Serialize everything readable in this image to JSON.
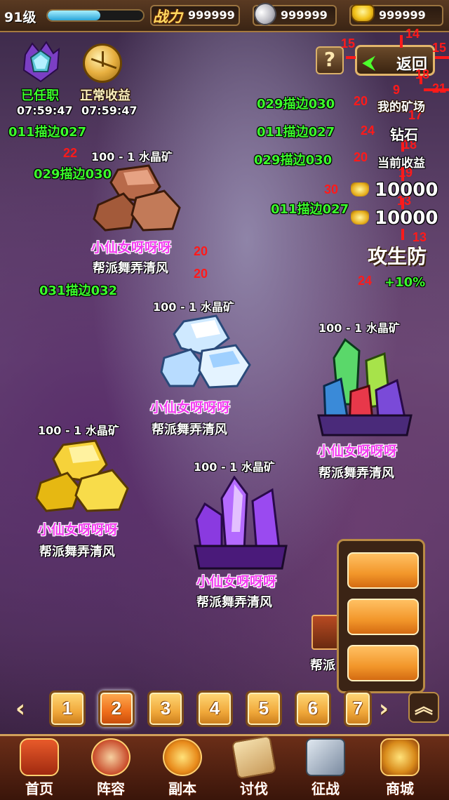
{
  "topbar": {
    "level": "91级",
    "power_label": "战力",
    "power_value": "999999",
    "silver_value": "999999",
    "gold_value": "999999",
    "xp_fraction": 0.55
  },
  "header_buttons": {
    "help_label": "?",
    "back_label": "返回"
  },
  "status_icons": [
    {
      "label": "已任职",
      "timer": "07:59:47"
    },
    {
      "label": "正常收益",
      "timer": "07:59:47"
    }
  ],
  "annotations": {
    "a_top_left": "011描边027",
    "a_left_2": "029描边030",
    "a_left_3": "031描边032",
    "a_right_1": "029描边030",
    "a_right_2": "011描边027",
    "a_right_3": "029描边030",
    "a_right_4": "011描边027"
  },
  "red_numbers": {
    "n15a": "15",
    "n14": "14",
    "n15b": "15",
    "n18a": "18",
    "n21": "21",
    "n9": "9",
    "n20a": "20",
    "n17": "17",
    "n24a": "24",
    "n18b": "18",
    "n20b": "20",
    "n19": "19",
    "n30": "30",
    "n13a": "13",
    "n13b": "13",
    "n24b": "24",
    "n22": "22",
    "n20c": "20",
    "n20d": "20"
  },
  "info_panel": {
    "my_mine": "我的矿场",
    "diamond": "钻石",
    "current_income": "当前收益",
    "income_1": "10000",
    "income_2": "10000",
    "atk_def": "攻生防",
    "bonus": "+10%"
  },
  "mines": [
    {
      "title": "100 - 1 水晶矿",
      "owner": "小仙女呀呀呀",
      "guild": "帮派舞弄清风",
      "type": "brown"
    },
    {
      "title": "100 - 1 水晶矿",
      "owner": "小仙女呀呀呀",
      "guild": "帮派舞弄清风",
      "type": "diamond"
    },
    {
      "title": "100 - 1 水晶矿",
      "owner": "小仙女呀呀呀",
      "guild": "帮派舞弄清风",
      "type": "rainbow"
    },
    {
      "title": "100 - 1 水晶矿",
      "owner": "小仙女呀呀呀",
      "guild": "帮派舞弄清风",
      "type": "gold"
    },
    {
      "title": "100 - 1 水晶矿",
      "owner": "小仙女呀呀呀",
      "guild": "帮派舞弄清风",
      "type": "purple"
    }
  ],
  "partial_guild": "帮派",
  "pager": {
    "pages": [
      "1",
      "2",
      "3",
      "4",
      "5",
      "6",
      "7"
    ],
    "active": "2",
    "prev": "‹",
    "next": "›",
    "up": "︽"
  },
  "nav": [
    "首页",
    "阵容",
    "副本",
    "讨伐",
    "征战",
    "商城"
  ],
  "colors": {
    "accent_green": "#3cff2c",
    "owner_pink": "#f23cf0",
    "annotation_red": "#ff1a1a",
    "button_orange": "#f2962a"
  }
}
